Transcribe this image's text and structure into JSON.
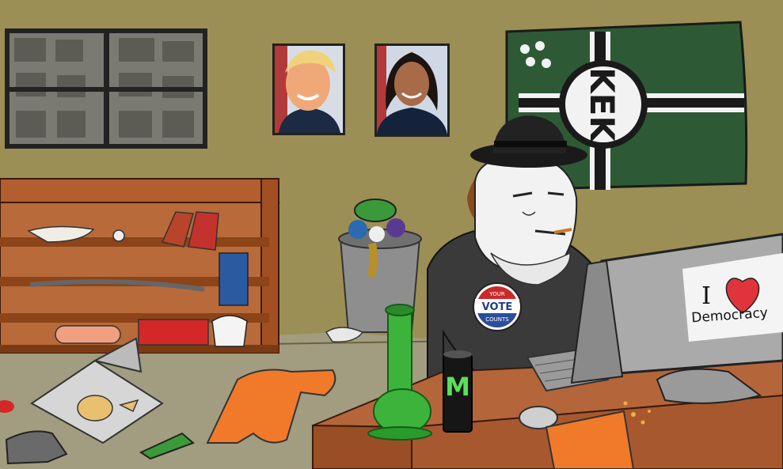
{
  "monitor_screen": {
    "letter": "I",
    "word": "Democracy"
  },
  "sticker": {
    "top": "YOUR",
    "middle": "VOTE",
    "bottom": "COUNTS"
  },
  "flag": {
    "emblem_text": "KEK"
  },
  "can": {
    "logo": "M"
  },
  "colors": {
    "wall": "#9c8f55",
    "floor": "#a09a7e",
    "desk": "#a0522d",
    "flag_green": "#2d5a35",
    "heart": "#e0343c"
  }
}
